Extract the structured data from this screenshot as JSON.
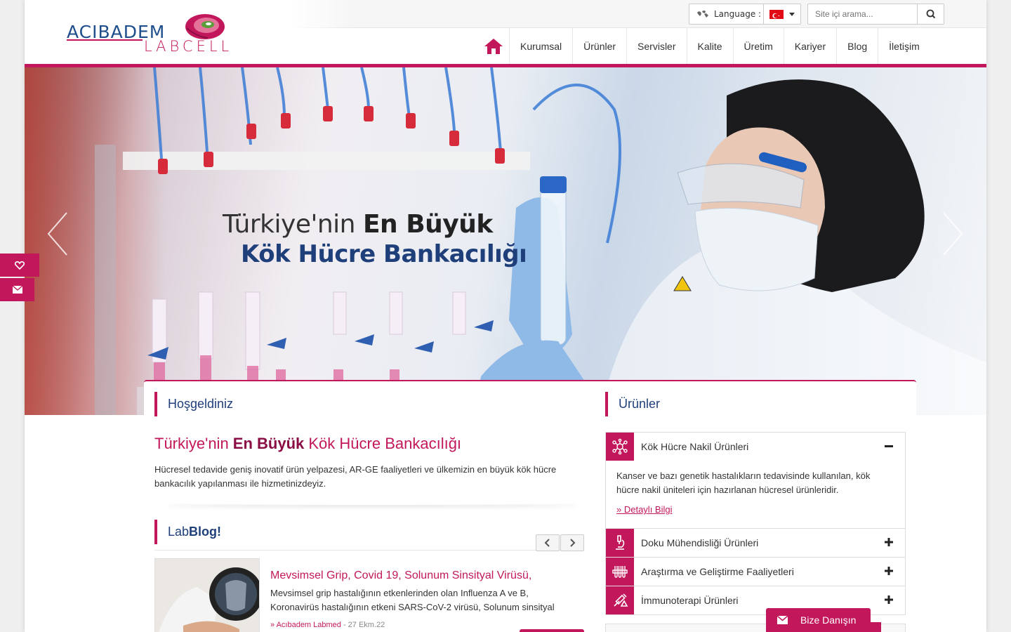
{
  "header": {
    "logo_line1": "ACIBADEM",
    "logo_line2": "LABCELL",
    "language_label": "Language :",
    "search_placeholder": "Site içi arama...",
    "nav": [
      "Kurumsal",
      "Ürünler",
      "Servisler",
      "Kalite",
      "Üretim",
      "Kariyer",
      "Blog",
      "İletişim"
    ]
  },
  "hero": {
    "line1_light": "Türkiye'nin ",
    "line1_bold": "En Büyük",
    "line2": "Kök Hücre Bankacılığı"
  },
  "welcome": {
    "section_title": "Hoşgeldiniz",
    "headline_pre": "Türkiye'nin ",
    "headline_bold": "En Büyük",
    "headline_post": " Kök Hücre Bankacılığı",
    "lead": "Hücresel tedavide geniş inovatif ürün yelpazesi, AR-GE faaliyetleri ve ülkemizin en büyük kök hücre bankacılık yapılanması ile hizmetinizdeyiz."
  },
  "blog": {
    "title_light": "Lab",
    "title_bold": "Blog!",
    "post_title": "Mevsimsel Grip, Covid 19, Solunum Sinsityal Virüsü,",
    "post_excerpt": "Mevsimsel grip hastalığının etkenlerinden olan Influenza A ve B, Koronavirüs hastalığının etkeni SARS-CoV-2 virüsü, Solunum sinsityal",
    "post_author": "» Acıbadem Labmed",
    "post_date": " - 27 Ekm.22"
  },
  "products": {
    "section_title": "Ürünler",
    "items": [
      {
        "label": "Kök Hücre Nakil Ürünleri",
        "expanded": true,
        "body": "Kanser ve bazı genetik hastalıkların tedavisinde kullanılan, kök hücre nakil üniteleri için hazırlanan hücresel ürünleridir.",
        "link": "» Detaylı Bilgi",
        "icon": "stem-cell-icon"
      },
      {
        "label": "Doku Mühendisliği Ürünleri",
        "expanded": false,
        "icon": "microscope-icon"
      },
      {
        "label": "Araştırma ve Geliştirme Faaliyetleri",
        "expanded": false,
        "icon": "test-tubes-icon"
      },
      {
        "label": "İmmunoterapi Ürünleri",
        "expanded": false,
        "icon": "syringe-icon"
      }
    ]
  },
  "floating": {
    "consult_label": "Bize Danışın"
  },
  "colors": {
    "accent": "#c2185b",
    "navy": "#1f3f7a"
  }
}
